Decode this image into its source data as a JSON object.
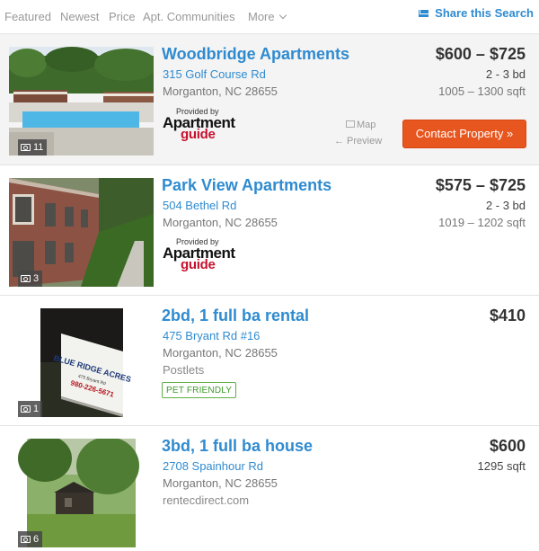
{
  "sort_tabs": [
    {
      "label": "Featured"
    },
    {
      "label": "Newest"
    },
    {
      "label": "Price"
    },
    {
      "label": "Apt. Communities"
    },
    {
      "label": "More"
    }
  ],
  "share_label": "Share this Search",
  "listings": [
    {
      "title": "Woodbridge Apartments",
      "address": "315 Golf Course Rd",
      "city": "Morganton, NC 28655",
      "price": "$600 – $725",
      "beds": "2 - 3 bd",
      "sqft": "1005 – 1300 sqft",
      "photo_count": "11",
      "provided_by": "Provided by",
      "provider_line1": "Apartment",
      "provider_line2": "guide",
      "map_label": "Map",
      "preview_label": "← Preview",
      "contact_label": "Contact Property »"
    },
    {
      "title": "Park View Apartments",
      "address": "504 Bethel Rd",
      "city": "Morganton, NC 28655",
      "price": "$575 – $725",
      "beds": "2 - 3 bd",
      "sqft": "1019 – 1202 sqft",
      "photo_count": "3",
      "provided_by": "Provided by",
      "provider_line1": "Apartment",
      "provider_line2": "guide"
    },
    {
      "title": "2bd, 1 full ba rental",
      "address": "475 Bryant Rd #16",
      "city": "Morganton, NC 28655",
      "source": "Postlets",
      "badge": "PET FRIENDLY",
      "price": "$410",
      "photo_count": "1",
      "sign_line1": "BLUE RIDGE ACRES",
      "sign_line2": "475 Bryant Rd",
      "sign_line3": "980-226-5671"
    },
    {
      "title": "3bd, 1 full ba house",
      "address": "2708 Spainhour Rd",
      "city": "Morganton, NC 28655",
      "source": "rentecdirect.com",
      "price": "$600",
      "sqft": "1295 sqft",
      "photo_count": "6"
    }
  ]
}
